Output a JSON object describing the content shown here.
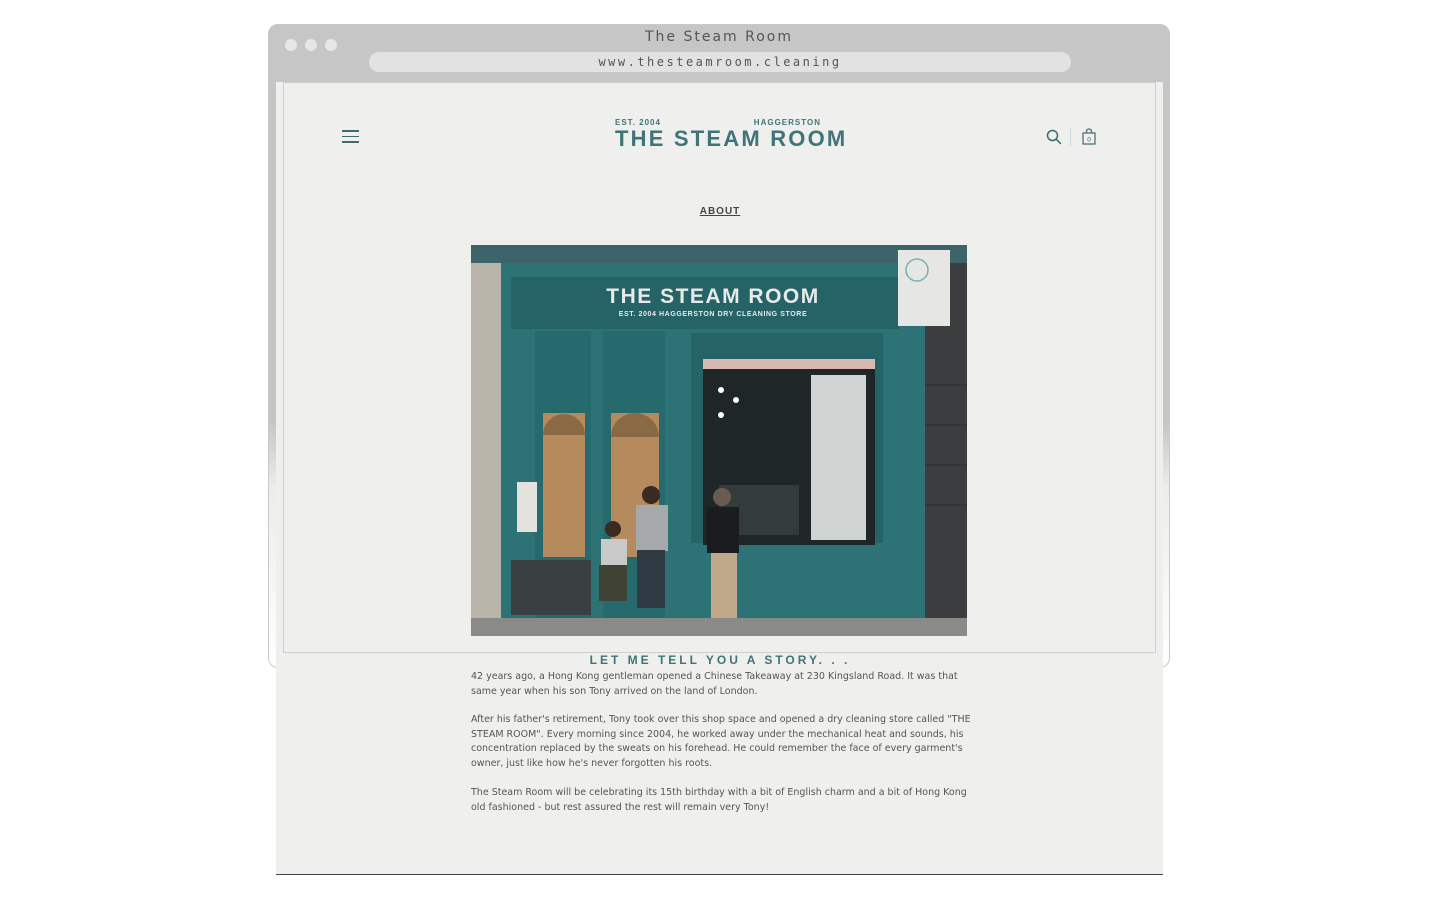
{
  "window": {
    "title": "The Steam Room",
    "url": "www.thesteamroom.cleaning"
  },
  "header": {
    "logo_est": "EST. 2004",
    "logo_location": "HAGGERSTON",
    "logo_name": "THE STEAM ROOM",
    "cart_count": "0"
  },
  "nav": {
    "about_label": "ABOUT"
  },
  "photo": {
    "sign_title": "THE STEAM ROOM",
    "sign_sub": "EST. 2004   HAGGERSTON   DRY  CLEANING  STORE"
  },
  "story": {
    "heading": "LET ME TELL YOU A STORY. . .",
    "p1": "42 years ago, a Hong Kong gentleman opened a Chinese Takeaway at 230 Kingsland Road. It was that same year when his son Tony arrived on the land of London.",
    "p2": "After his father's retirement, Tony took over this shop space and opened a dry cleaning store called \"THE STEAM ROOM\". Every morning since 2004, he worked away under the mechanical heat and sounds, his concentration replaced by the sweats on his forehead. He could remember the face of every garment's owner, just like how he's never forgotten his roots.",
    "p3": "The Steam Room will be celebrating its 15th birthday with a bit of English charm and a bit of Hong Kong old fashioned - but rest assured the rest will remain very Tony!"
  },
  "colors": {
    "brand_teal": "#3f7479",
    "page_bg": "#efefed",
    "chrome_gray": "#c6c6c6"
  }
}
